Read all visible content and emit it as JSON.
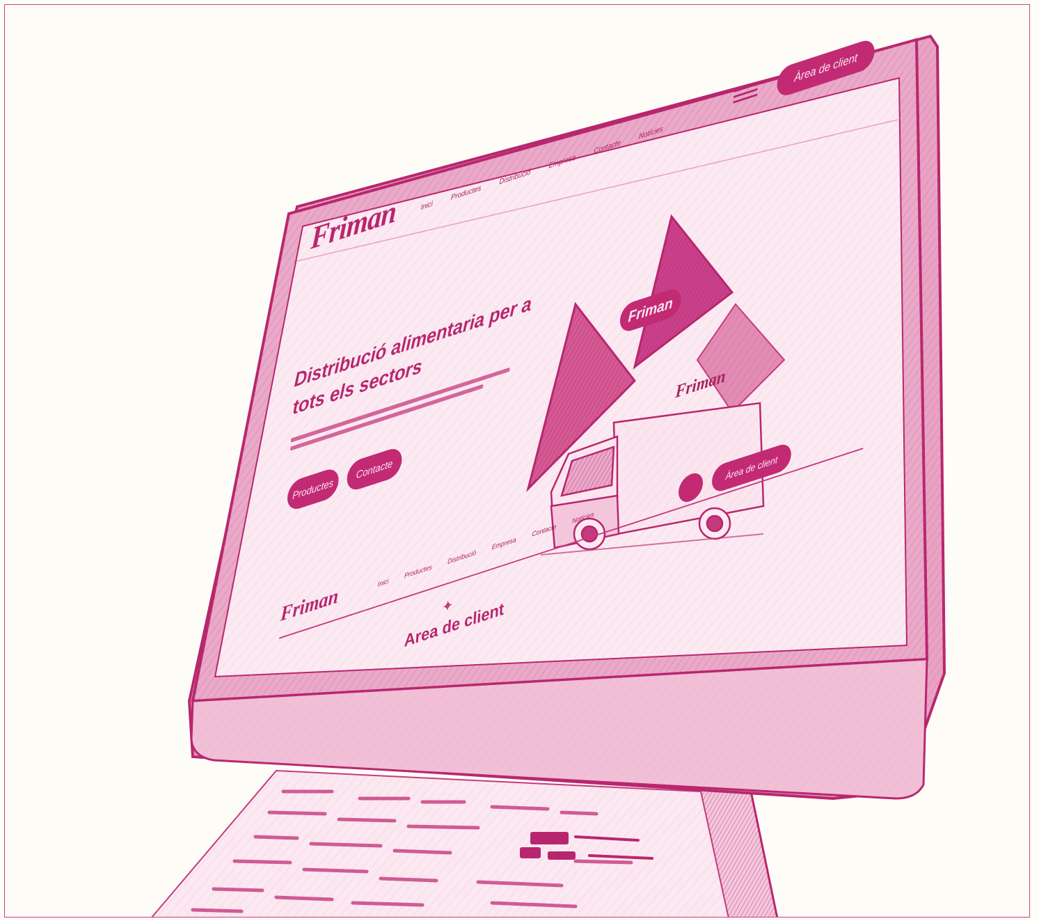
{
  "site": {
    "logo": "Friman",
    "nav": [
      "Inici",
      "Productes",
      "Distribució",
      "Empresa",
      "Contacte",
      "Notícies"
    ],
    "client_button": "Àrea de client",
    "hero_title": "Distribució alimentaria per a tots els sectors",
    "hero_primary_button": "Productes",
    "hero_secondary_button": "Contacte",
    "badge": "Friman",
    "truck_brand": "Friman",
    "bottom_logo": "Friman",
    "bottom_nav": [
      "Inici",
      "Productes",
      "Distribució",
      "Empresa",
      "Contacte",
      "Notícies"
    ],
    "signup_button": "Àrea de client",
    "area_title": "Area de client"
  },
  "colors": {
    "accent": "#c22a74",
    "text": "#b8266e",
    "background": "#fdfcf7"
  }
}
